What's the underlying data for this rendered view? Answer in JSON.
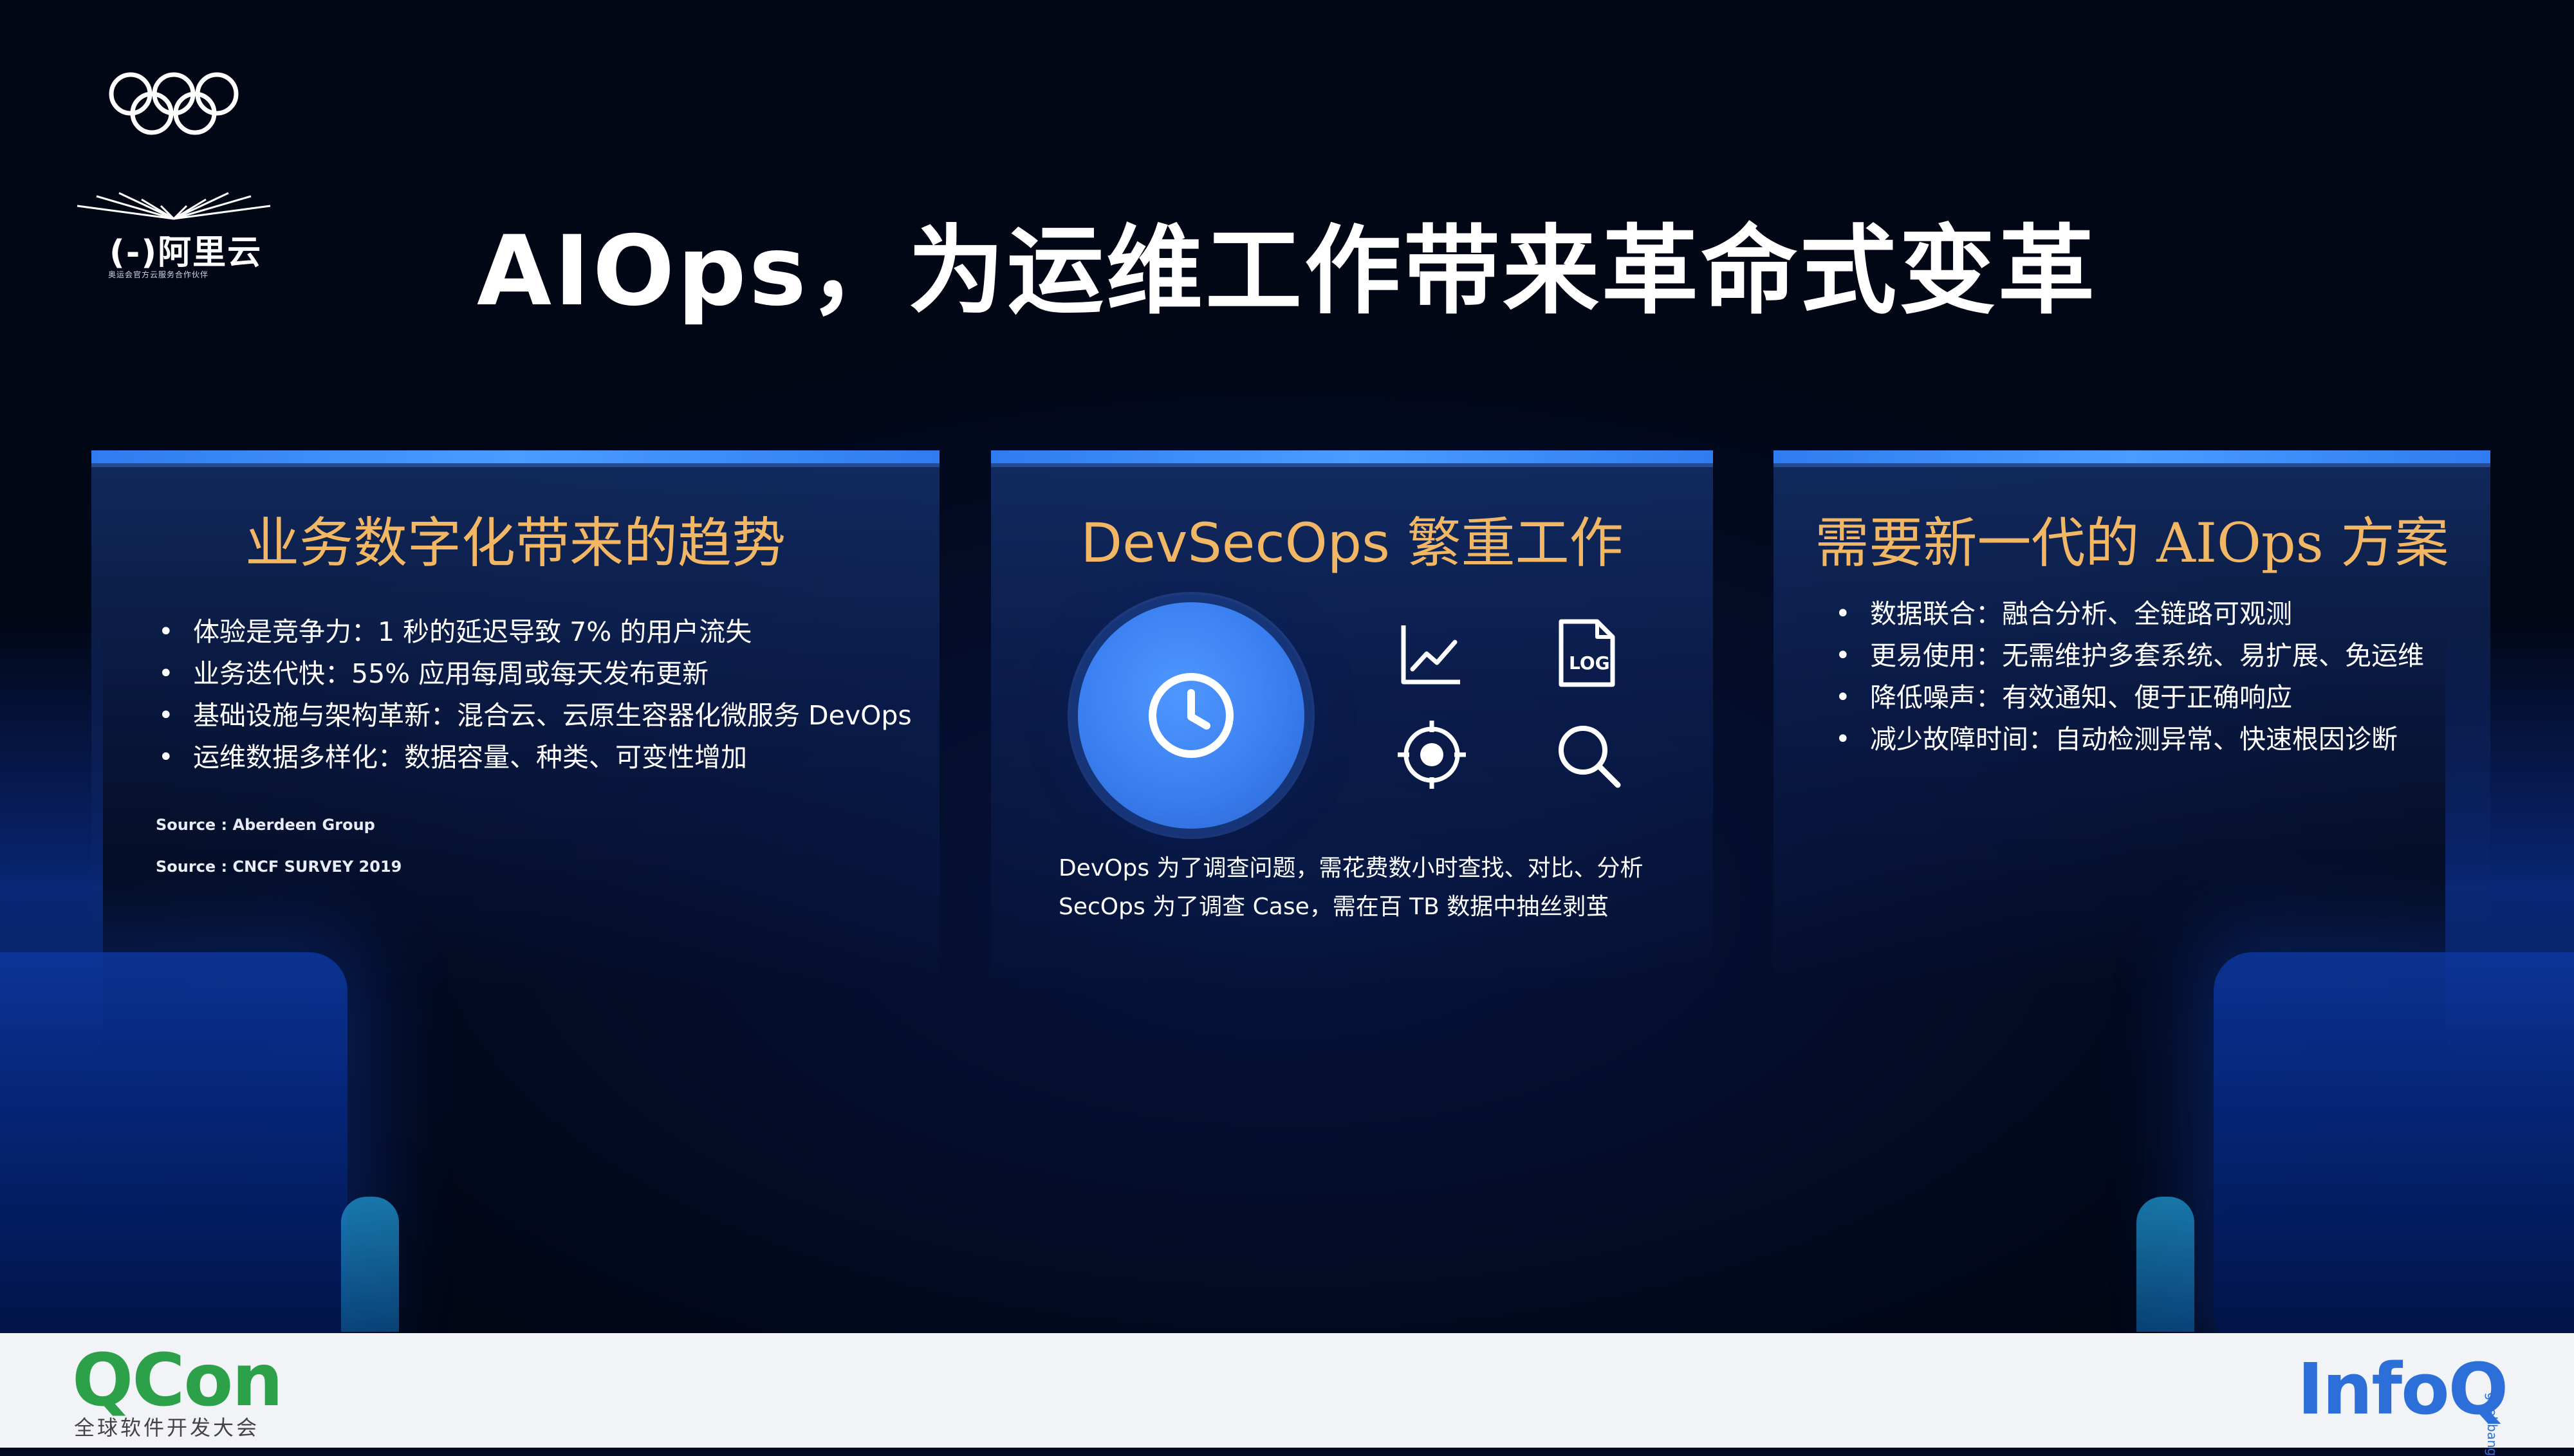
{
  "slide": {
    "title": "AIOps，为运维工作带来革命式变革"
  },
  "brand": {
    "name": "(-)阿里云",
    "tagline": "奥运会官方云服务合作伙伴"
  },
  "panels": [
    {
      "title": "业务数字化带来的趋势",
      "bullets": [
        "体验是竞争力：1 秒的延迟导致 7% 的用户流失",
        "业务迭代快：55% 应用每周或每天发布更新",
        "基础设施与架构革新：混合云、云原生容器化微服务 DevOps",
        "运维数据多样化：数据容量、种类、可变性增加"
      ],
      "sources": [
        "Source : Aberdeen Group",
        "Source : CNCF SURVEY 2019"
      ]
    },
    {
      "title": "DevSecOps 繁重工作",
      "icons": [
        "clock-icon",
        "line-chart-icon",
        "log-file-icon",
        "target-icon",
        "search-icon"
      ],
      "log_label": "LOG",
      "lines": [
        "DevOps 为了调查问题，需花费数小时查找、对比、分析",
        "SecOps 为了调查 Case，需在百 TB 数据中抽丝剥茧"
      ]
    },
    {
      "title": "需要新一代的 AIOps 方案",
      "bullets": [
        "数据联合：融合分析、全链路可观测",
        "更易使用：无需维护多套系统、易扩展、免运维",
        "降低噪声：有效通知、便于正确响应",
        "减少故障时间：自动检测异常、快速根因诊断"
      ]
    }
  ],
  "footer": {
    "qcon": "QCon",
    "qcon_sub": "全球软件开发大会",
    "infoq": "InfoQ",
    "infoq_side": "geekbang"
  },
  "colors": {
    "accent_title": "#f2b765",
    "panel_bar": "#3a86f5",
    "clock": "#3a7ff0",
    "qcon_green": "#2da04a",
    "infoq_blue": "#2d6fd8"
  }
}
